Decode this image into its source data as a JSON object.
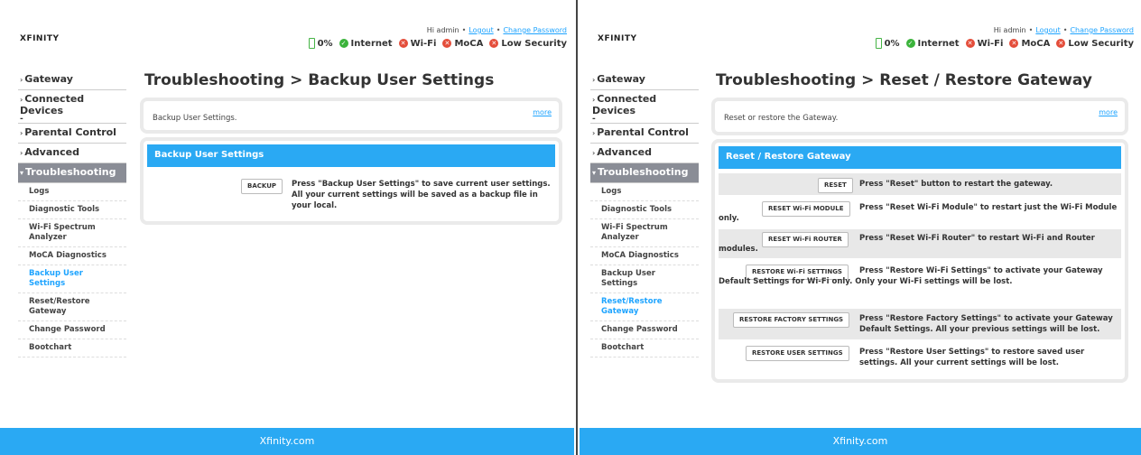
{
  "header": {
    "logo": "XFINITY",
    "greeting": "Hi admin",
    "logout": "Logout",
    "change_password": "Change Password",
    "battery": "0%",
    "status": [
      {
        "label": "Internet",
        "state": "ok"
      },
      {
        "label": "Wi-Fi",
        "state": "bad"
      },
      {
        "label": "MoCA",
        "state": "bad"
      },
      {
        "label": "Low Security",
        "state": "bad"
      }
    ]
  },
  "nav": {
    "items": [
      "Gateway",
      "Connected Devices",
      "Parental Control",
      "Advanced",
      "Troubleshooting"
    ],
    "sub": [
      "Logs",
      "Diagnostic Tools",
      "Wi-Fi Spectrum Analyzer",
      "MoCA Diagnostics",
      "Backup User Settings",
      "Reset/Restore Gateway",
      "Change Password",
      "Bootchart"
    ],
    "marker": "-"
  },
  "left": {
    "title": "Troubleshooting > Backup User Settings",
    "intro": "Backup User Settings.",
    "more": "more",
    "section": "Backup User Settings",
    "button": "BACKUP",
    "desc": "Press \"Backup User Settings\" to save current user settings. All your current settings will be saved as a backup file in your local."
  },
  "right": {
    "title": "Troubleshooting > Reset / Restore Gateway",
    "intro": "Reset or restore the Gateway.",
    "more": "more",
    "section": "Reset / Restore Gateway",
    "rows": [
      {
        "button": "RESET",
        "desc": "Press \"Reset\" button to restart the gateway."
      },
      {
        "button": "RESET Wi-Fi MODULE",
        "desc": "Press \"Reset Wi-Fi Module\" to restart just the Wi-Fi Module only."
      },
      {
        "button": "RESET Wi-Fi ROUTER",
        "desc": "Press \"Reset Wi-Fi Router\" to restart Wi-Fi and Router modules."
      },
      {
        "button": "RESTORE Wi-Fi SETTINGS",
        "desc": "Press \"Restore Wi-Fi Settings\" to activate your Gateway Default Settings for Wi-Fi only. Only your Wi-Fi settings will be lost."
      },
      {
        "button": "RESTORE FACTORY SETTINGS",
        "desc": "Press \"Restore Factory Settings\" to activate your Gateway Default Settings. All your previous settings will be lost."
      },
      {
        "button": "RESTORE USER SETTINGS",
        "desc": "Press \"Restore User Settings\" to restore saved user settings. All your current settings will be lost."
      }
    ]
  },
  "footer": "Xfinity.com",
  "colors": {
    "accent": "#2aa9f3",
    "link": "#1ea4ff",
    "nav_active": "#8a8d96",
    "ok": "#3bb33b",
    "bad": "#e44d3a"
  }
}
